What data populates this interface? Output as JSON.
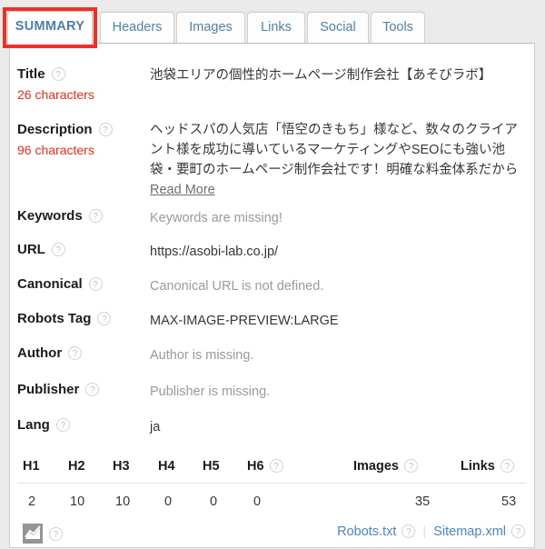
{
  "tabs": [
    {
      "label": "SUMMARY",
      "active": true
    },
    {
      "label": "Headers",
      "active": false
    },
    {
      "label": "Images",
      "active": false
    },
    {
      "label": "Links",
      "active": false
    },
    {
      "label": "Social",
      "active": false
    },
    {
      "label": "Tools",
      "active": false
    }
  ],
  "annotation": {
    "color": "#ee3124",
    "target": "SUMMARY"
  },
  "help_glyph": "?",
  "fields": {
    "title": {
      "label": "Title",
      "count": "26 characters",
      "value": "池袋エリアの個性的ホームページ制作会社【あそびラボ】"
    },
    "description": {
      "label": "Description",
      "count": "96 characters",
      "value": "ヘッドスパの人気店「悟空のきもち」様など、数々のクライアント様を成功に導いているマーケティングやSEOにも強い池袋・要町のホームページ制作会社です！明確な料金体系だから",
      "read_more": "Read More"
    },
    "keywords": {
      "label": "Keywords",
      "value": "Keywords are missing!",
      "muted": true
    },
    "url": {
      "label": "URL",
      "value": "https://asobi-lab.co.jp/",
      "muted": false
    },
    "canonical": {
      "label": "Canonical",
      "value": "Canonical URL is not defined.",
      "muted": true
    },
    "robots_tag": {
      "label": "Robots Tag",
      "value": "MAX-IMAGE-PREVIEW:LARGE",
      "muted": false
    },
    "author": {
      "label": "Author",
      "value": "Author is missing.",
      "muted": true
    },
    "publisher": {
      "label": "Publisher",
      "value": "Publisher is missing.",
      "muted": true
    },
    "lang": {
      "label": "Lang",
      "value": "ja",
      "muted": false
    }
  },
  "headings_table": {
    "columns": [
      "H1",
      "H2",
      "H3",
      "H4",
      "H5",
      "H6",
      "Images",
      "Links"
    ],
    "values": [
      "2",
      "10",
      "10",
      "0",
      "0",
      "0",
      "35",
      "53"
    ]
  },
  "footer": {
    "chart_icon": "chart-icon",
    "robots_link": "Robots.txt",
    "separator": "|",
    "sitemap_link": "Sitemap.xml"
  },
  "colors": {
    "accent_red": "#f32b18",
    "link_blue": "#4a86c8",
    "tab_blue": "#4f83b0",
    "muted_gray": "#9a9a9a",
    "annotation_red": "#ee3124"
  }
}
